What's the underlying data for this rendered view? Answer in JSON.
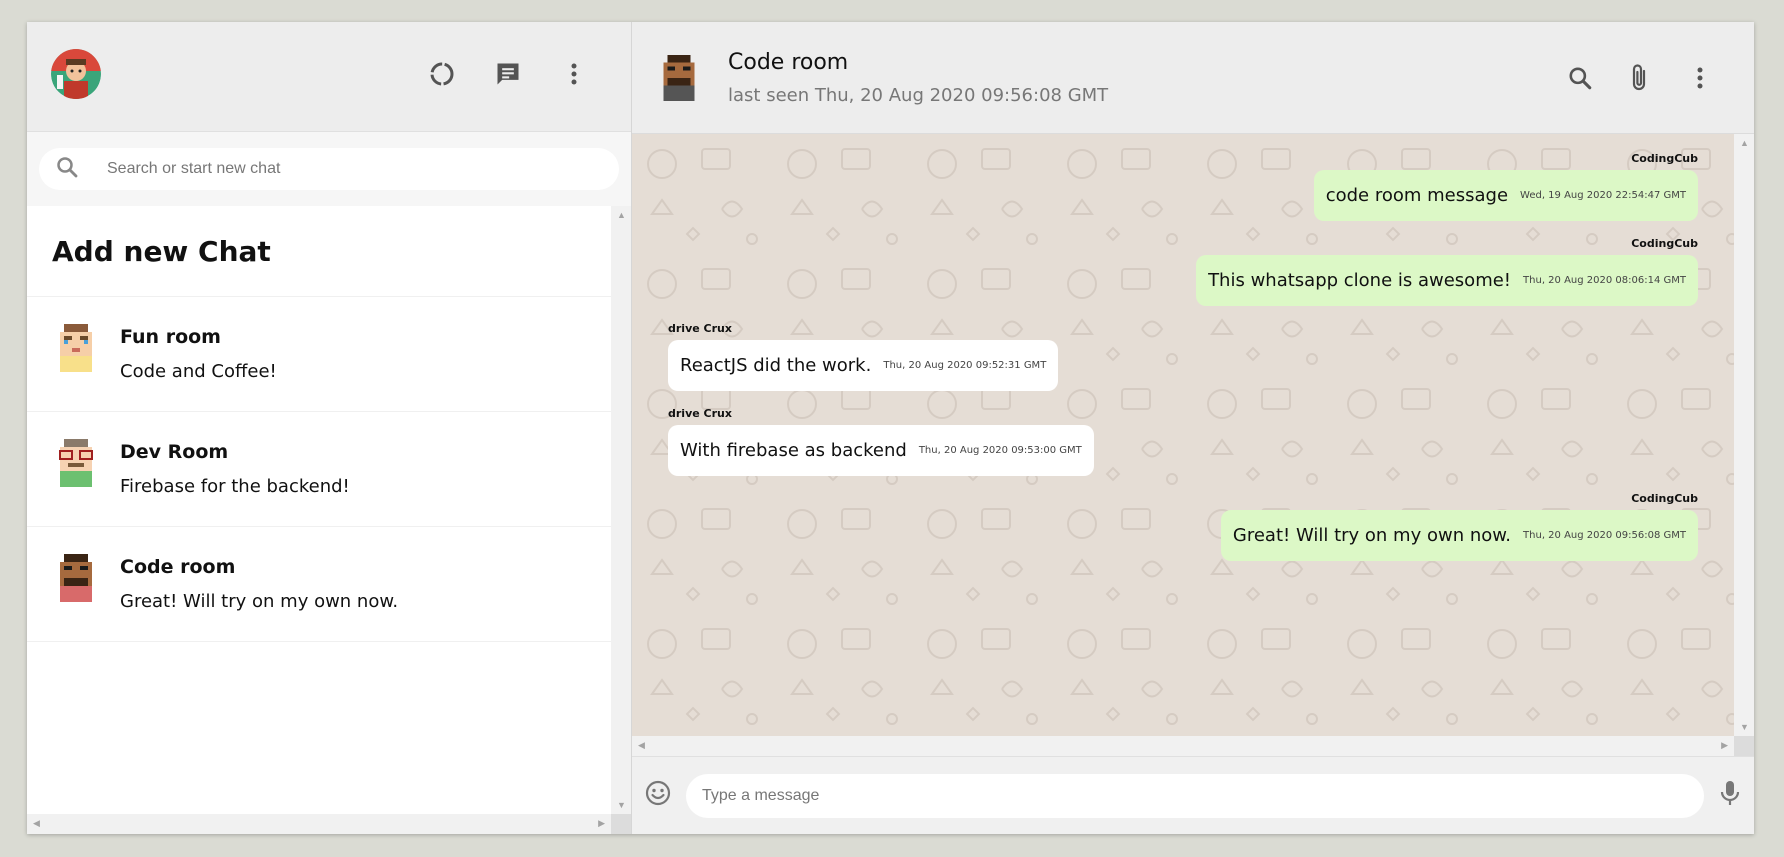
{
  "sidebar": {
    "header": {
      "icons": [
        "status-icon",
        "new-chat-icon",
        "more-vert-icon"
      ]
    },
    "search": {
      "placeholder": "Search or start new chat"
    },
    "add_chat_label": "Add new Chat",
    "chats": [
      {
        "name": "Fun room",
        "last_message": "Code and Coffee!"
      },
      {
        "name": "Dev Room",
        "last_message": "Firebase for the backend!"
      },
      {
        "name": "Code room",
        "last_message": "Great! Will try on my own now."
      }
    ]
  },
  "chat": {
    "title": "Code room",
    "last_seen": "last seen Thu, 20 Aug 2020 09:56:08 GMT",
    "header_icons": [
      "search-icon",
      "attach-icon",
      "more-vert-icon"
    ],
    "messages": [
      {
        "sender": "CodingCub",
        "text": "code room message",
        "time": "Wed, 19 Aug 2020 22:54:47 GMT",
        "sent": true
      },
      {
        "sender": "CodingCub",
        "text": "This whatsapp clone is awesome!",
        "time": "Thu, 20 Aug 2020 08:06:14 GMT",
        "sent": true
      },
      {
        "sender": "drive Crux",
        "text": "ReactJS did the work.",
        "time": "Thu, 20 Aug 2020 09:52:31 GMT",
        "sent": false
      },
      {
        "sender": "drive Crux",
        "text": "With firebase as backend",
        "time": "Thu, 20 Aug 2020 09:53:00 GMT",
        "sent": false
      },
      {
        "sender": "CodingCub",
        "text": "Great! Will try on my own now.",
        "time": "Thu, 20 Aug 2020 09:56:08 GMT",
        "sent": true
      }
    ],
    "input": {
      "placeholder": "Type a message"
    },
    "footer_icons": [
      "emoji-icon",
      "mic-icon"
    ]
  },
  "colors": {
    "sent_bubble": "#dcf8c6",
    "received_bubble": "#ffffff",
    "chat_background": "#e5ddd5",
    "header_background": "#ededed"
  }
}
